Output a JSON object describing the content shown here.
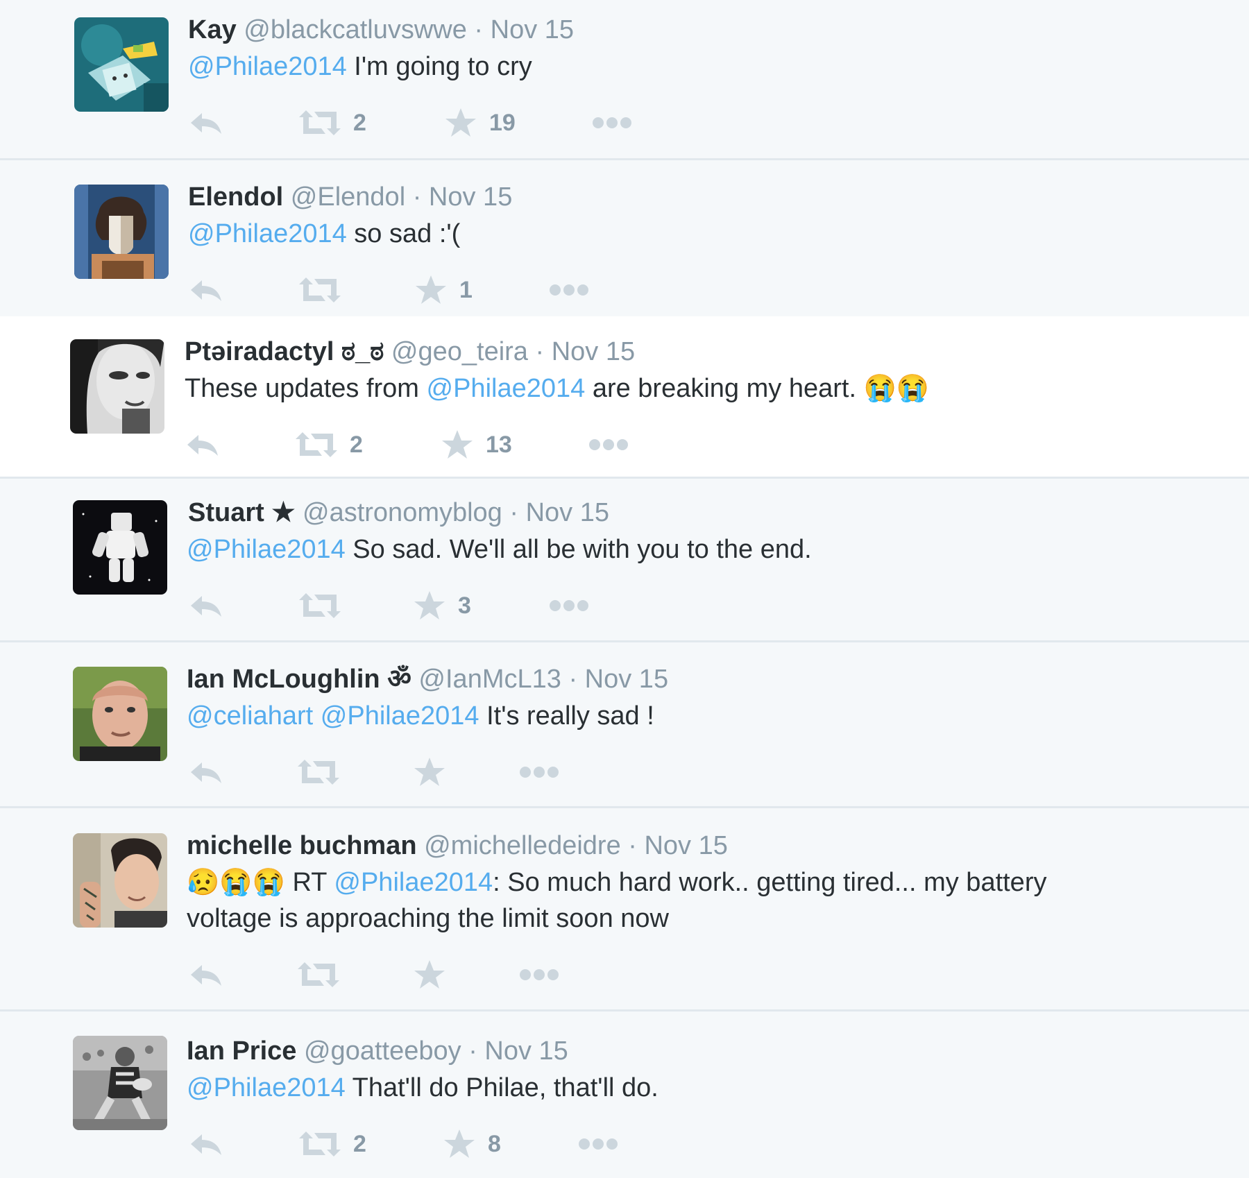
{
  "tweets": [
    {
      "fullname": "Kay",
      "badge": "",
      "username": "@blackcatluvswwe",
      "dot": "·",
      "time": "Nov 15",
      "text_parts": [
        {
          "type": "mention",
          "text": "@Philae2014"
        },
        {
          "type": "text",
          "text": " I'm going to cry"
        }
      ],
      "retweet_count": "2",
      "favorite_count": "19",
      "avatar": "robot-cartoon-avatar"
    },
    {
      "fullname": "Elendol",
      "badge": "",
      "username": "@Elendol",
      "dot": "·",
      "time": "Nov 15",
      "text_parts": [
        {
          "type": "mention",
          "text": "@Philae2014"
        },
        {
          "type": "text",
          "text": " so sad :'("
        }
      ],
      "retweet_count": "",
      "favorite_count": "1",
      "avatar": "masked-face-avatar"
    },
    {
      "fullname": "Ptəiradactyl ಠ_ಠ",
      "badge": "",
      "username": "@geo_teira",
      "dot": "·",
      "time": "Nov 15",
      "text_parts": [
        {
          "type": "text",
          "text": "These updates from "
        },
        {
          "type": "mention",
          "text": "@Philae2014"
        },
        {
          "type": "text",
          "text": " are breaking my heart. "
        },
        {
          "type": "emoji",
          "text": "😭"
        },
        {
          "type": "emoji",
          "text": "😭"
        }
      ],
      "retweet_count": "2",
      "favorite_count": "13",
      "avatar": "woman-portrait-avatar"
    },
    {
      "fullname": "Stuart",
      "badge": "★",
      "username": "@astronomyblog",
      "dot": "·",
      "time": "Nov 15",
      "text_parts": [
        {
          "type": "mention",
          "text": "@Philae2014"
        },
        {
          "type": "text",
          "text": " So sad. We'll all be with you to the end."
        }
      ],
      "retweet_count": "",
      "favorite_count": "3",
      "avatar": "astronaut-space-avatar"
    },
    {
      "fullname": "Ian McLoughlin",
      "badge": "ॐ",
      "username": "@IanMcL13",
      "dot": "·",
      "time": "Nov 15",
      "text_parts": [
        {
          "type": "mention",
          "text": "@celiahart"
        },
        {
          "type": "text",
          "text": " "
        },
        {
          "type": "mention",
          "text": "@Philae2014"
        },
        {
          "type": "text",
          "text": " It's really sad !"
        }
      ],
      "retweet_count": "",
      "favorite_count": "",
      "avatar": "man-portrait-avatar"
    },
    {
      "fullname": "michelle buchman",
      "badge": "",
      "username": "@michelledeidre",
      "dot": "·",
      "time": "Nov 15",
      "text_parts": [
        {
          "type": "emoji",
          "text": "😥"
        },
        {
          "type": "emoji",
          "text": "😭"
        },
        {
          "type": "emoji",
          "text": "😭"
        },
        {
          "type": "text",
          "text": " RT "
        },
        {
          "type": "mention",
          "text": "@Philae2014"
        },
        {
          "type": "text",
          "text": ": So much hard work.. getting tired... my battery"
        },
        {
          "type": "break",
          "text": ""
        },
        {
          "type": "text",
          "text": "voltage is approaching the limit soon now"
        }
      ],
      "retweet_count": "",
      "favorite_count": "",
      "avatar": "tattoo-woman-avatar"
    },
    {
      "fullname": "Ian Price",
      "badge": "",
      "username": "@goatteeboy",
      "dot": "·",
      "time": "Nov 15",
      "text_parts": [
        {
          "type": "mention",
          "text": "@Philae2014"
        },
        {
          "type": "text",
          "text": " That'll do Philae, that'll do."
        }
      ],
      "retweet_count": "2",
      "favorite_count": "8",
      "avatar": "rugby-player-avatar"
    }
  ],
  "icons": {
    "reply": "reply-icon",
    "retweet": "retweet-icon",
    "favorite": "star-icon",
    "more": "more-dots-icon"
  },
  "colors": {
    "background": "#f5f8fa",
    "mention": "#55acee",
    "muted": "#8899a6",
    "icon": "#ccd6dd",
    "text": "#292f33"
  }
}
